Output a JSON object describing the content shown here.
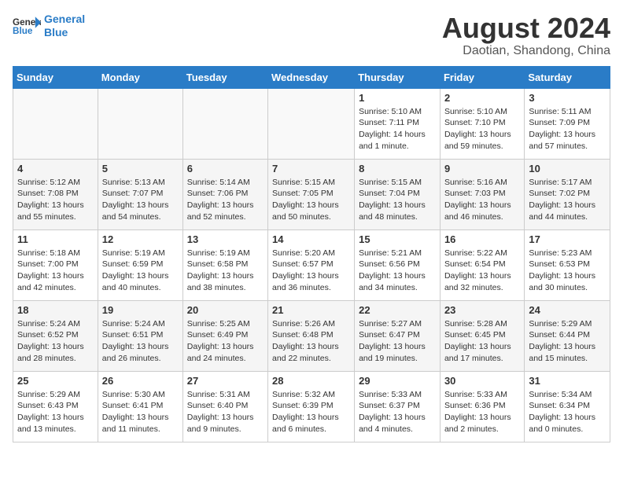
{
  "header": {
    "logo_line1": "General",
    "logo_line2": "Blue",
    "month_year": "August 2024",
    "location": "Daotian, Shandong, China"
  },
  "weekdays": [
    "Sunday",
    "Monday",
    "Tuesday",
    "Wednesday",
    "Thursday",
    "Friday",
    "Saturday"
  ],
  "weeks": [
    [
      {
        "day": "",
        "info": ""
      },
      {
        "day": "",
        "info": ""
      },
      {
        "day": "",
        "info": ""
      },
      {
        "day": "",
        "info": ""
      },
      {
        "day": "1",
        "info": "Sunrise: 5:10 AM\nSunset: 7:11 PM\nDaylight: 14 hours\nand 1 minute."
      },
      {
        "day": "2",
        "info": "Sunrise: 5:10 AM\nSunset: 7:10 PM\nDaylight: 13 hours\nand 59 minutes."
      },
      {
        "day": "3",
        "info": "Sunrise: 5:11 AM\nSunset: 7:09 PM\nDaylight: 13 hours\nand 57 minutes."
      }
    ],
    [
      {
        "day": "4",
        "info": "Sunrise: 5:12 AM\nSunset: 7:08 PM\nDaylight: 13 hours\nand 55 minutes."
      },
      {
        "day": "5",
        "info": "Sunrise: 5:13 AM\nSunset: 7:07 PM\nDaylight: 13 hours\nand 54 minutes."
      },
      {
        "day": "6",
        "info": "Sunrise: 5:14 AM\nSunset: 7:06 PM\nDaylight: 13 hours\nand 52 minutes."
      },
      {
        "day": "7",
        "info": "Sunrise: 5:15 AM\nSunset: 7:05 PM\nDaylight: 13 hours\nand 50 minutes."
      },
      {
        "day": "8",
        "info": "Sunrise: 5:15 AM\nSunset: 7:04 PM\nDaylight: 13 hours\nand 48 minutes."
      },
      {
        "day": "9",
        "info": "Sunrise: 5:16 AM\nSunset: 7:03 PM\nDaylight: 13 hours\nand 46 minutes."
      },
      {
        "day": "10",
        "info": "Sunrise: 5:17 AM\nSunset: 7:02 PM\nDaylight: 13 hours\nand 44 minutes."
      }
    ],
    [
      {
        "day": "11",
        "info": "Sunrise: 5:18 AM\nSunset: 7:00 PM\nDaylight: 13 hours\nand 42 minutes."
      },
      {
        "day": "12",
        "info": "Sunrise: 5:19 AM\nSunset: 6:59 PM\nDaylight: 13 hours\nand 40 minutes."
      },
      {
        "day": "13",
        "info": "Sunrise: 5:19 AM\nSunset: 6:58 PM\nDaylight: 13 hours\nand 38 minutes."
      },
      {
        "day": "14",
        "info": "Sunrise: 5:20 AM\nSunset: 6:57 PM\nDaylight: 13 hours\nand 36 minutes."
      },
      {
        "day": "15",
        "info": "Sunrise: 5:21 AM\nSunset: 6:56 PM\nDaylight: 13 hours\nand 34 minutes."
      },
      {
        "day": "16",
        "info": "Sunrise: 5:22 AM\nSunset: 6:54 PM\nDaylight: 13 hours\nand 32 minutes."
      },
      {
        "day": "17",
        "info": "Sunrise: 5:23 AM\nSunset: 6:53 PM\nDaylight: 13 hours\nand 30 minutes."
      }
    ],
    [
      {
        "day": "18",
        "info": "Sunrise: 5:24 AM\nSunset: 6:52 PM\nDaylight: 13 hours\nand 28 minutes."
      },
      {
        "day": "19",
        "info": "Sunrise: 5:24 AM\nSunset: 6:51 PM\nDaylight: 13 hours\nand 26 minutes."
      },
      {
        "day": "20",
        "info": "Sunrise: 5:25 AM\nSunset: 6:49 PM\nDaylight: 13 hours\nand 24 minutes."
      },
      {
        "day": "21",
        "info": "Sunrise: 5:26 AM\nSunset: 6:48 PM\nDaylight: 13 hours\nand 22 minutes."
      },
      {
        "day": "22",
        "info": "Sunrise: 5:27 AM\nSunset: 6:47 PM\nDaylight: 13 hours\nand 19 minutes."
      },
      {
        "day": "23",
        "info": "Sunrise: 5:28 AM\nSunset: 6:45 PM\nDaylight: 13 hours\nand 17 minutes."
      },
      {
        "day": "24",
        "info": "Sunrise: 5:29 AM\nSunset: 6:44 PM\nDaylight: 13 hours\nand 15 minutes."
      }
    ],
    [
      {
        "day": "25",
        "info": "Sunrise: 5:29 AM\nSunset: 6:43 PM\nDaylight: 13 hours\nand 13 minutes."
      },
      {
        "day": "26",
        "info": "Sunrise: 5:30 AM\nSunset: 6:41 PM\nDaylight: 13 hours\nand 11 minutes."
      },
      {
        "day": "27",
        "info": "Sunrise: 5:31 AM\nSunset: 6:40 PM\nDaylight: 13 hours\nand 9 minutes."
      },
      {
        "day": "28",
        "info": "Sunrise: 5:32 AM\nSunset: 6:39 PM\nDaylight: 13 hours\nand 6 minutes."
      },
      {
        "day": "29",
        "info": "Sunrise: 5:33 AM\nSunset: 6:37 PM\nDaylight: 13 hours\nand 4 minutes."
      },
      {
        "day": "30",
        "info": "Sunrise: 5:33 AM\nSunset: 6:36 PM\nDaylight: 13 hours\nand 2 minutes."
      },
      {
        "day": "31",
        "info": "Sunrise: 5:34 AM\nSunset: 6:34 PM\nDaylight: 13 hours\nand 0 minutes."
      }
    ]
  ]
}
